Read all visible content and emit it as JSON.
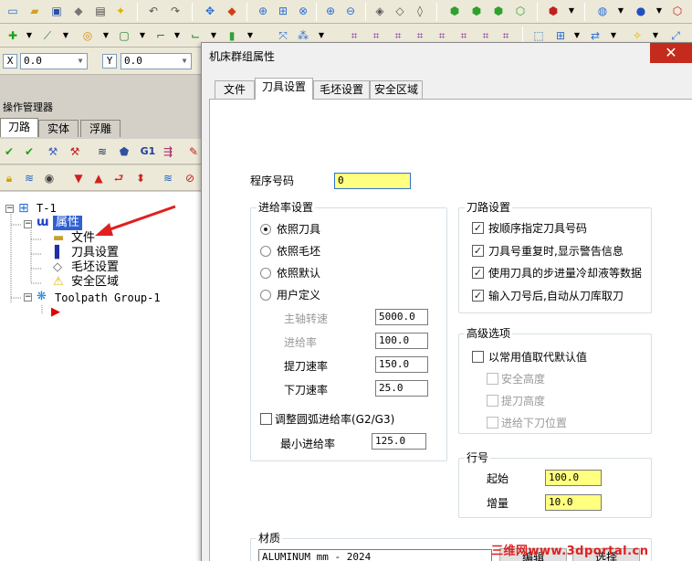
{
  "coords": {
    "x_label": "X",
    "x_value": "0.0",
    "y_label": "Y",
    "y_value": "0.0"
  },
  "left_panel": {
    "title": "操作管理器",
    "tabs": [
      "刀路",
      "实体",
      "浮雕"
    ],
    "g1_label": "G1",
    "tree": {
      "root": "T-1",
      "properties": "属性",
      "files": "文件",
      "tool_settings": "刀具设置",
      "stock_setup": "毛坯设置",
      "safety_zone": "安全区域",
      "toolpath_group": "Toolpath Group-1"
    }
  },
  "dialog": {
    "title": "机床群组属性",
    "close": "✕",
    "tabs": [
      "文件",
      "刀具设置",
      "毛坯设置",
      "安全区域"
    ],
    "active_tab": 1,
    "program_number_label": "程序号码",
    "program_number_value": "0",
    "feed_group": {
      "title": "进给率设置",
      "options": [
        "依照刀具",
        "依照毛坯",
        "依照默认",
        "用户定义"
      ],
      "selected": 0,
      "spindle_label": "主轴转速",
      "spindle_value": "5000.0",
      "feed_label": "进给率",
      "feed_value": "100.0",
      "retract_label": "提刀速率",
      "retract_value": "150.0",
      "plunge_label": "下刀速率",
      "plunge_value": "25.0",
      "arc_adjust_label": "调整圆弧进给率(G2/G3)",
      "arc_adjust_checked": false,
      "min_feed_label": "最小进给率",
      "min_feed_value": "125.0"
    },
    "toolpath_group": {
      "title": "刀路设置",
      "options": [
        {
          "label": "按顺序指定刀具号码",
          "checked": true
        },
        {
          "label": "刀具号重复时,显示警告信息",
          "checked": true
        },
        {
          "label": "使用刀具的步进量冷却液等数据",
          "checked": true
        },
        {
          "label": "输入刀号后,自动从刀库取刀",
          "checked": true
        }
      ]
    },
    "advanced_group": {
      "title": "高级选项",
      "main_label": "以常用值取代默认值",
      "main_checked": false,
      "sub": [
        "安全高度",
        "提刀高度",
        "进给下刀位置"
      ]
    },
    "line_group": {
      "title": "行号",
      "start_label": "起始",
      "start_value": "100.0",
      "inc_label": "增量",
      "inc_value": "10.0"
    },
    "material_group": {
      "title": "材质",
      "value": "ALUMINUM mm - 2024",
      "edit_button": "编辑",
      "select_button": "选择"
    }
  },
  "watermark": "三维网www.3dportal.cn",
  "colors": {
    "highlight_yellow": "#ffff80",
    "close_red": "#c42b1c",
    "arrow_red": "#e02020",
    "title_bar": "#f0f0f0"
  }
}
